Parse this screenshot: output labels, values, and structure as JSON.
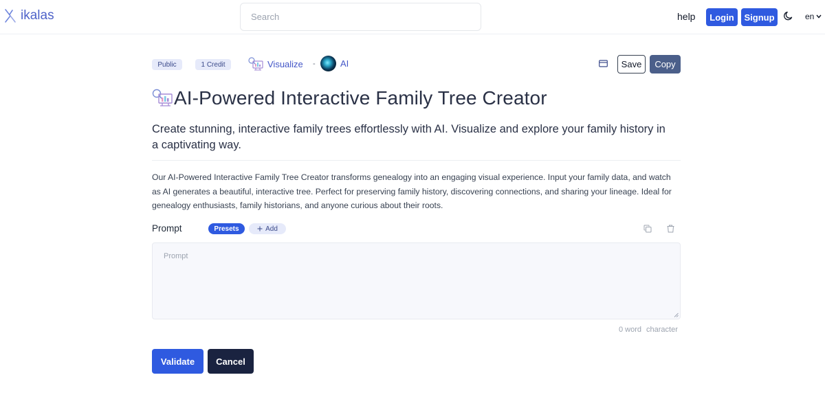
{
  "header": {
    "logo_text": "ikalas",
    "search_placeholder": "Search",
    "help_label": "help",
    "login_label": "Login",
    "signup_label": "Signup",
    "language": "en"
  },
  "meta": {
    "visibility_badge": "Public",
    "credit_badge": "1 Credit",
    "category_label": "Visualize",
    "separator": "-",
    "model_label": "AI",
    "save_label": "Save",
    "copy_label": "Copy"
  },
  "page": {
    "title": "AI-Powered Interactive Family Tree Creator",
    "subtitle": "Create stunning, interactive family trees effortlessly with AI. Visualize and explore your family history in a captivating way.",
    "description": "Our AI-Powered Interactive Family Tree Creator transforms genealogy into an engaging visual experience. Input your family data, and watch as AI generates a beautiful, interactive tree. Perfect for preserving family history, discovering connections, and sharing your lineage. Ideal for genealogy enthusiasts, family historians, and anyone curious about their roots."
  },
  "prompt": {
    "label": "Prompt",
    "presets_label": "Presets",
    "add_label": "Add",
    "placeholder": "Prompt",
    "value": "",
    "word_count": "0 word",
    "character_label": "character"
  },
  "actions": {
    "validate_label": "Validate",
    "cancel_label": "Cancel"
  },
  "colors": {
    "primary": "#2f5ae0",
    "dark": "#1a2340",
    "copy_button": "#4b5f8a",
    "badge_bg": "#e6eafa",
    "link": "#4356c7"
  },
  "icons": {
    "logo": "ikalas-logo-icon",
    "theme": "moon-icon",
    "language": "chevron-down-icon",
    "category": "visualize-icon",
    "card": "credit-card-icon",
    "copy": "copy-icon",
    "delete": "trash-icon",
    "add": "plus-icon"
  }
}
